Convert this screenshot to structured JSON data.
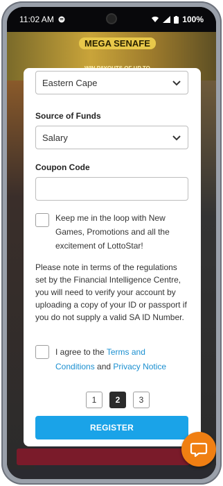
{
  "status_bar": {
    "time": "11:02 AM",
    "battery": "100%"
  },
  "background": {
    "banner_title": "MEGA SENAFE",
    "banner_subtitle": "WIN PAYOUTS OF UP TO"
  },
  "form": {
    "province": {
      "value": "Eastern Cape"
    },
    "source_of_funds": {
      "label": "Source of Funds",
      "value": "Salary"
    },
    "coupon_code": {
      "label": "Coupon Code",
      "value": "",
      "placeholder": ""
    },
    "newsletter": {
      "line1": "Keep me in the loop with New",
      "line2": "Games, Promotions and all the",
      "line3": "excitement of LottoStar!",
      "checked": false
    },
    "notice": "Please note in terms of the regulations set by the Financial Intelligence Centre, you will need to verify your account by uploading a copy of your ID or passport if you do not supply a valid SA ID Number.",
    "terms": {
      "prefix": "I agree to the ",
      "terms_link": "Terms and",
      "terms_link_2": "Conditions",
      "and": " and ",
      "privacy_link": "Privacy Notice",
      "checked": false
    },
    "pagination": {
      "pages": [
        "1",
        "2",
        "3"
      ],
      "current": "2"
    },
    "register_label": "REGISTER"
  },
  "colors": {
    "accent": "#1aa3e8",
    "link": "#1a8fd0",
    "chat": "#f07f12",
    "active_page": "#2b2b2b"
  },
  "icons": {
    "dropdown": "chevron-down-icon",
    "chat": "chat-bubble-icon"
  }
}
